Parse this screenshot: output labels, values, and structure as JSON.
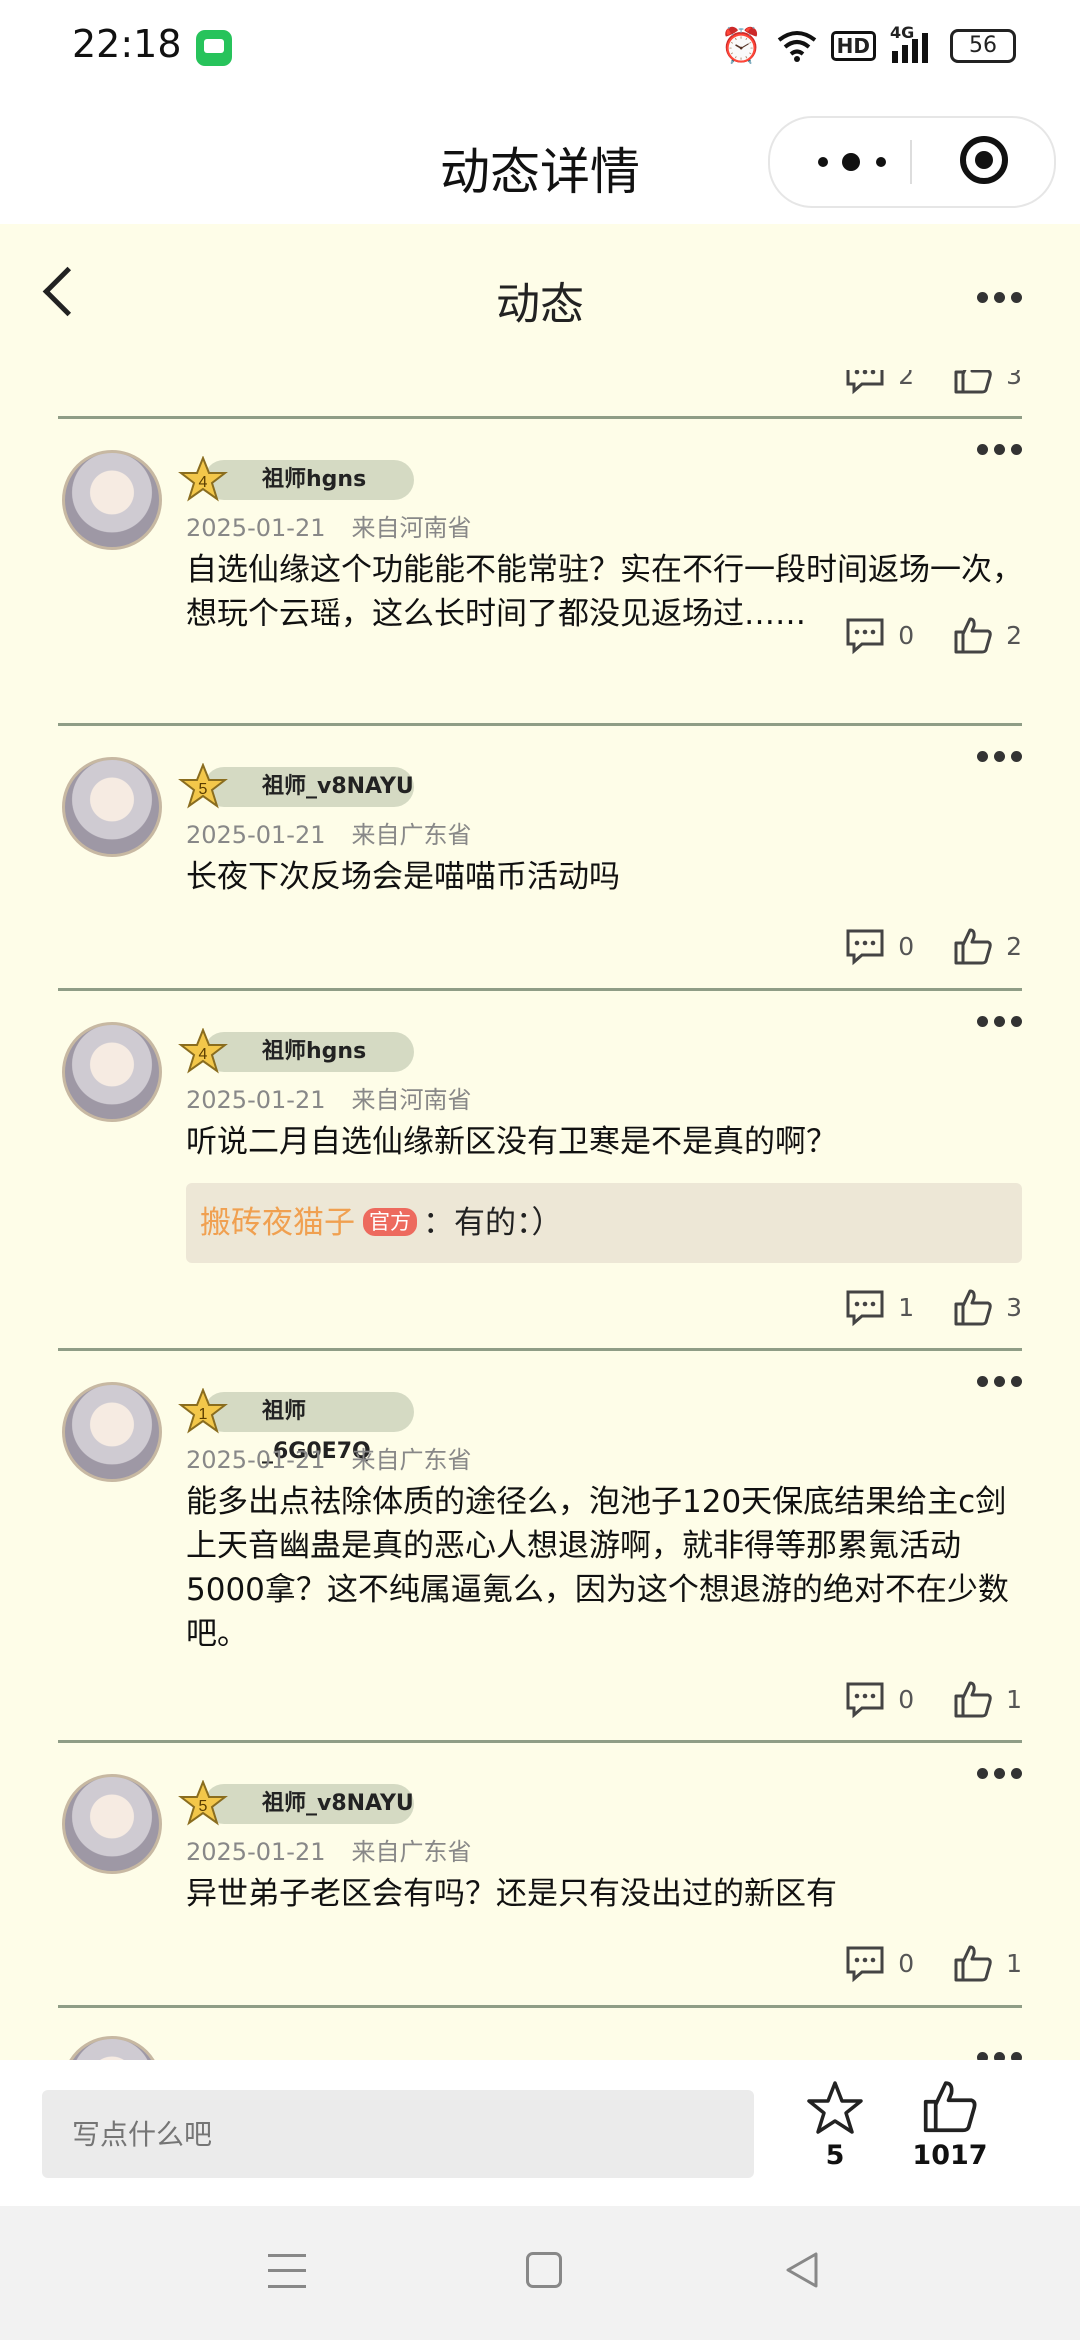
{
  "status_bar": {
    "time": "22:18",
    "network": "4G",
    "hd": "HD",
    "battery": "56",
    "icons": [
      "wechat-icon",
      "alarm-icon",
      "wifi-icon",
      "hd-icon",
      "signal-icon",
      "battery-icon"
    ]
  },
  "header": {
    "title": "动态详情",
    "capsule_icons": [
      "more-dots-icon",
      "close-target-icon"
    ]
  },
  "nav": {
    "title": "动态",
    "back_icon": "chevron-left-icon",
    "more_icon": "more-dots-icon"
  },
  "partial_top": {
    "comments": "2",
    "likes": "3"
  },
  "posts": [
    {
      "level": "4",
      "name": "祖师hgns",
      "date": "2025-01-21",
      "location": "来自河南省",
      "content": "自选仙缘这个功能能不能常驻？实在不行一段时间返场一次，想玩个云瑶，这么长时间了都没见返场过……",
      "comments": "0",
      "likes": "2"
    },
    {
      "level": "5",
      "name": "祖师_v8NAYU",
      "date": "2025-01-21",
      "location": "来自广东省",
      "content": "长夜下次反场会是喵喵币活动吗",
      "comments": "0",
      "likes": "2"
    },
    {
      "level": "4",
      "name": "祖师hgns",
      "date": "2025-01-21",
      "location": "来自河南省",
      "content": "听说二月自选仙缘新区没有卫寒是不是真的啊？",
      "reply": {
        "name": "搬砖夜猫子",
        "badge": "官方",
        "sep": "：",
        "text": "有的：）"
      },
      "comments": "1",
      "likes": "3"
    },
    {
      "level": "1",
      "name": "祖师_6G0E7Q",
      "date": "2025-01-21",
      "location": "来自广东省",
      "content": "能多出点祛除体质的途径么，泡池子120天保底结果给主c剑上天音幽蛊是真的恶心人想退游啊，就非得等那累氪活动5000拿？这不纯属逼氪么，因为这个想退游的绝对不在少数吧。",
      "comments": "0",
      "likes": "1"
    },
    {
      "level": "5",
      "name": "祖师_v8NAYU",
      "date": "2025-01-21",
      "location": "来自广东省",
      "content": "异世弟子老区会有吗？还是只有没出过的新区有",
      "comments": "0",
      "likes": "1"
    }
  ],
  "bottom": {
    "placeholder": "写点什么吧",
    "favorites": "5",
    "likes": "1017"
  },
  "colors": {
    "background": "#fefde8",
    "divider": "#8f9d86",
    "name_pill": "#d5dac3",
    "official_name": "#f0a050",
    "official_badge": "#ed6a5e",
    "star": "#f3c74a"
  }
}
